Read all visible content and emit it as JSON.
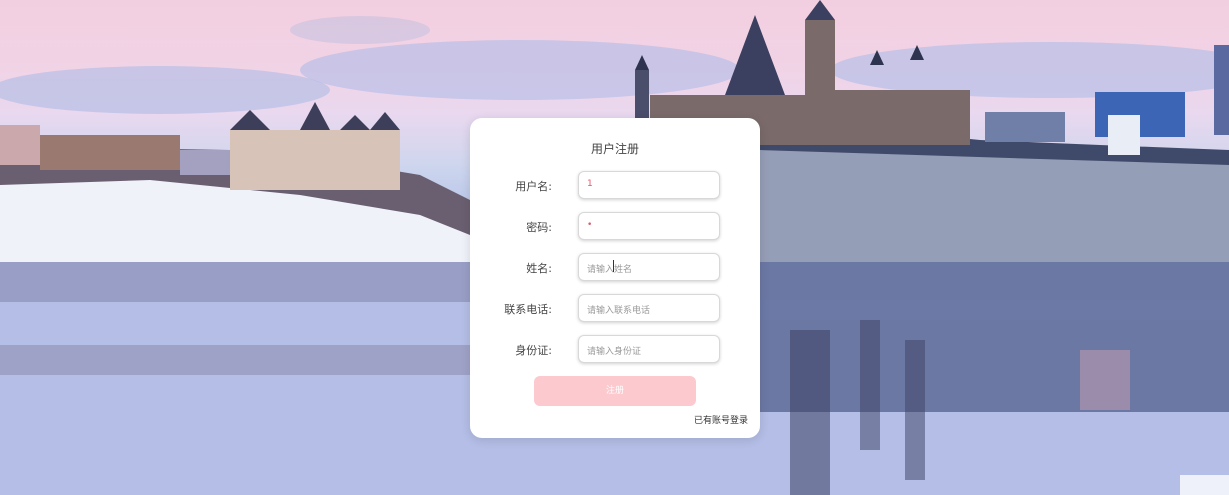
{
  "form": {
    "title": "用户注册",
    "fields": [
      {
        "label": "用户名:",
        "value": "1",
        "placeholder": ""
      },
      {
        "label": "密码:",
        "value": "•",
        "placeholder": ""
      },
      {
        "label": "姓名:",
        "value": "",
        "placeholder": "请输入姓名"
      },
      {
        "label": "联系电话:",
        "value": "",
        "placeholder": "请输入联系电话"
      },
      {
        "label": "身份证:",
        "value": "",
        "placeholder": "请输入身份证"
      }
    ],
    "submit_label": "注册",
    "login_link": "已有账号登录"
  },
  "colors": {
    "button": "#fcc9cf",
    "card": "#ffffff",
    "value_text": "#e05a6a"
  }
}
